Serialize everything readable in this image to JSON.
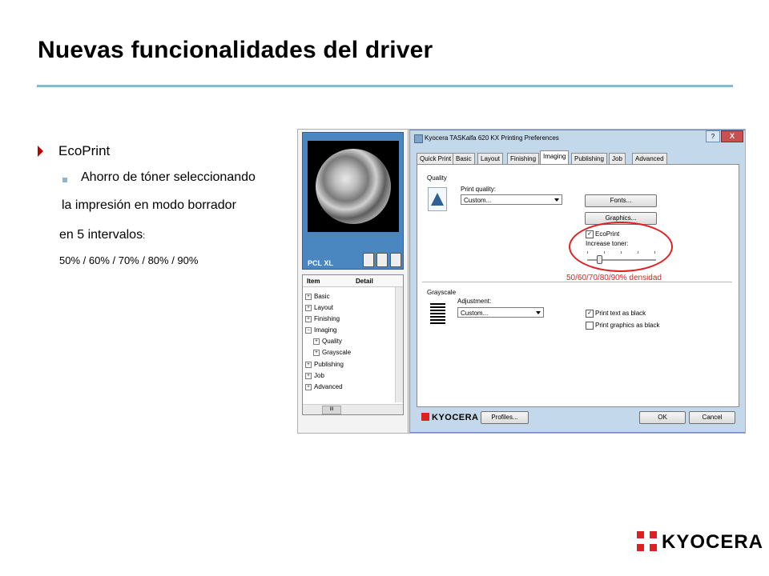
{
  "slide": {
    "title": "Nuevas funcionalidades del driver",
    "bullet": "EcoPrint",
    "sub1": "Ahorro de tóner seleccionando",
    "sub2": "la impresión en modo borrador",
    "sub3": "en 5 intervalos",
    "sub3_colon": ":",
    "sub4": "50% / 60% / 70% / 80% / 90%",
    "logo_text": "KYOCERA",
    "accent": "#c00000",
    "rule_color": "#8fb4cf"
  },
  "left_pane": {
    "pcl_label": "PCL XL",
    "tree_headers": [
      "Item",
      "Detail"
    ],
    "tree_items": [
      "Basic",
      "Layout",
      "Finishing",
      "Imaging",
      "Quality",
      "Grayscale",
      "Publishing",
      "Job",
      "Advanced"
    ],
    "hscroll_label": "III"
  },
  "dialog": {
    "title": "Kyocera TASKalfa 620 KX Printing Preferences",
    "help": "?",
    "close": "X",
    "tabs": [
      "Quick Print",
      "Basic",
      "Layout",
      "Finishing",
      "Imaging",
      "Publishing",
      "Job",
      "Advanced"
    ],
    "active_tab": "Imaging",
    "quality_label": "Quality",
    "print_quality_label": "Print quality:",
    "print_quality_value": "Custom...",
    "fonts_btn": "Fonts...",
    "graphics_btn": "Graphics...",
    "ecoprint_label": "EcoPrint",
    "ecoprint_checked": true,
    "increase_toner_label": "Increase toner:",
    "grayscale_label": "Grayscale",
    "adjustment_label": "Adjustment:",
    "adjustment_value": "Custom...",
    "print_text_black": "Print text as black",
    "print_text_black_checked": true,
    "print_graphics_black": "Print graphics as black",
    "print_graphics_black_checked": false,
    "annotation": "50/60/70/80/90% densidad",
    "profiles_btn": "Profiles...",
    "ok_btn": "OK",
    "cancel_btn": "Cancel",
    "brand": "KYOCERA",
    "annotation_color": "#e02020"
  }
}
